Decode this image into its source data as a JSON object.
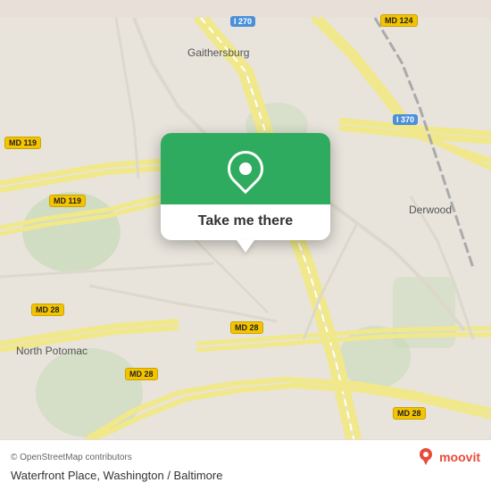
{
  "map": {
    "attribution": "© OpenStreetMap contributors",
    "center_label": "Gaithersburg",
    "alt_label": "Derwood",
    "alt_label2": "North Potomac"
  },
  "popup": {
    "button_label": "Take me there",
    "pin_icon": "location-pin"
  },
  "bottom_bar": {
    "copyright": "© OpenStreetMap contributors",
    "location_name": "Waterfront Place, Washington / Baltimore",
    "moovit_label": "moovit"
  },
  "road_labels": [
    {
      "id": "i270",
      "text": "I 270",
      "top": "20",
      "left": "280",
      "type": "highway"
    },
    {
      "id": "md124-top",
      "text": "MD 124",
      "top": "18",
      "left": "430",
      "type": "road"
    },
    {
      "id": "md119-left",
      "text": "MD 119",
      "top": "155",
      "left": "10",
      "type": "road"
    },
    {
      "id": "md119-mid",
      "text": "MD 119",
      "top": "218",
      "left": "60",
      "type": "road"
    },
    {
      "id": "md28-left",
      "text": "MD 28",
      "top": "338",
      "left": "42",
      "type": "road"
    },
    {
      "id": "md28-bottom",
      "text": "MD 28",
      "top": "410",
      "left": "148",
      "type": "road"
    },
    {
      "id": "md28-mid",
      "text": "MD 28",
      "top": "360",
      "left": "265",
      "type": "road"
    },
    {
      "id": "md28-right",
      "text": "MD 28",
      "top": "455",
      "left": "448",
      "type": "road"
    },
    {
      "id": "i370",
      "text": "I 370",
      "top": "130",
      "left": "446",
      "type": "highway"
    }
  ],
  "colors": {
    "map_bg": "#e8e4dc",
    "road_yellow": "#f5c400",
    "road_major": "#ffffff",
    "green": "#2eab5e",
    "highway_blue": "#4a90d9",
    "accent_red": "#e84b3a"
  }
}
